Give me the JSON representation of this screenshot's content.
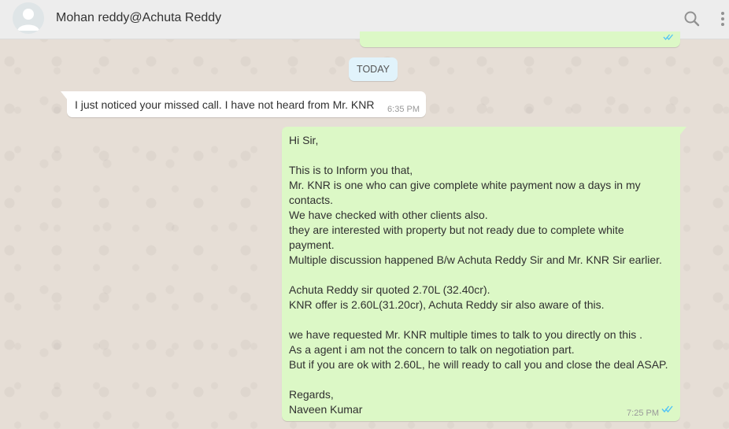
{
  "header": {
    "title": "Mohan reddy@Achuta Reddy",
    "avatar_icon": "default-avatar-icon",
    "search_icon": "search-icon",
    "menu_icon": "more-vertical-icon"
  },
  "day_separator": "TODAY",
  "messages": [
    {
      "direction": "in",
      "text": "I just noticed your missed call. I have not heard from Mr. KNR",
      "time": "6:35 PM"
    },
    {
      "direction": "out",
      "lines": [
        "Hi Sir,",
        "",
        "This is to Inform you that,",
        "Mr. KNR is one who can give complete white payment now a days in my",
        "contacts.",
        "We have checked with other clients also.",
        "they are interested with property but not ready due to complete white",
        "payment.",
        "Multiple discussion happened B/w Achuta Reddy Sir and Mr. KNR Sir earlier.",
        "",
        "Achuta Reddy sir quoted 2.70L (32.40cr).",
        "KNR offer is 2.60L(31.20cr), Achuta Reddy sir also aware of this.",
        "",
        "we have requested Mr. KNR multiple times to talk to you directly on this .",
        "As a agent i am not the concern to talk on negotiation part.",
        "But if you are ok with 2.60L, he will ready to call you and close the deal ASAP.",
        "",
        "Regards,",
        "Naveen Kumar"
      ],
      "time": "7:25 PM",
      "status": "read"
    }
  ],
  "colors": {
    "outgoing_bubble": "#dcf8c6",
    "incoming_bubble": "#ffffff",
    "read_ticks": "#4fc3f7",
    "header_bg": "#ededed",
    "day_pill": "#e1f3fb"
  }
}
